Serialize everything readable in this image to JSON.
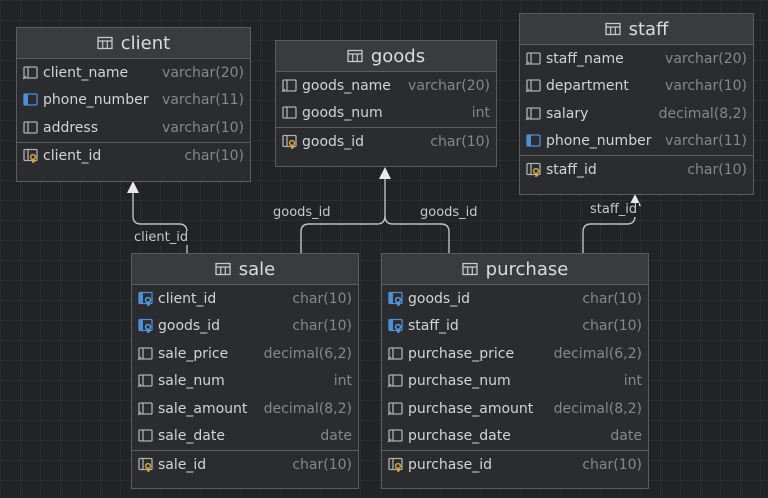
{
  "tables": {
    "client": {
      "title": "client",
      "fields": [
        {
          "name": "client_name",
          "type": "varchar(20)",
          "icon": "column-icon"
        },
        {
          "name": "phone_number",
          "type": "varchar(11)",
          "icon": "column-unique-icon"
        },
        {
          "name": "address",
          "type": "varchar(10)",
          "icon": "column-plain-icon"
        }
      ],
      "key": {
        "name": "client_id",
        "type": "char(10)",
        "icon": "primary-key-icon"
      }
    },
    "goods": {
      "title": "goods",
      "fields": [
        {
          "name": "goods_name",
          "type": "varchar(20)",
          "icon": "column-icon"
        },
        {
          "name": "goods_num",
          "type": "int",
          "icon": "column-plain-icon"
        }
      ],
      "key": {
        "name": "goods_id",
        "type": "char(10)",
        "icon": "primary-key-icon"
      }
    },
    "staff": {
      "title": "staff",
      "fields": [
        {
          "name": "staff_name",
          "type": "varchar(20)",
          "icon": "column-icon"
        },
        {
          "name": "department",
          "type": "varchar(10)",
          "icon": "column-icon"
        },
        {
          "name": "salary",
          "type": "decimal(8,2)",
          "icon": "column-icon"
        },
        {
          "name": "phone_number",
          "type": "varchar(11)",
          "icon": "column-unique-icon"
        }
      ],
      "key": {
        "name": "staff_id",
        "type": "char(10)",
        "icon": "primary-key-icon"
      }
    },
    "sale": {
      "title": "sale",
      "fields": [
        {
          "name": "client_id",
          "type": "char(10)",
          "icon": "foreign-key-icon"
        },
        {
          "name": "goods_id",
          "type": "char(10)",
          "icon": "foreign-key-icon"
        },
        {
          "name": "sale_price",
          "type": "decimal(6,2)",
          "icon": "column-icon"
        },
        {
          "name": "sale_num",
          "type": "int",
          "icon": "column-icon"
        },
        {
          "name": "sale_amount",
          "type": "decimal(8,2)",
          "icon": "column-icon"
        },
        {
          "name": "sale_date",
          "type": "date",
          "icon": "column-plain-icon"
        }
      ],
      "key": {
        "name": "sale_id",
        "type": "char(10)",
        "icon": "primary-key-icon"
      }
    },
    "purchase": {
      "title": "purchase",
      "fields": [
        {
          "name": "goods_id",
          "type": "char(10)",
          "icon": "foreign-key-icon"
        },
        {
          "name": "staff_id",
          "type": "char(10)",
          "icon": "foreign-key-icon"
        },
        {
          "name": "purchase_price",
          "type": "decimal(6,2)",
          "icon": "column-icon"
        },
        {
          "name": "purchase_num",
          "type": "int",
          "icon": "column-icon"
        },
        {
          "name": "purchase_amount",
          "type": "decimal(8,2)",
          "icon": "column-icon"
        },
        {
          "name": "purchase_date",
          "type": "date",
          "icon": "column-icon"
        }
      ],
      "key": {
        "name": "purchase_id",
        "type": "char(10)",
        "icon": "primary-key-icon"
      }
    }
  },
  "links": [
    {
      "from": "sale",
      "to": "client",
      "label": "client_id"
    },
    {
      "from": "sale",
      "to": "goods",
      "label": "goods_id"
    },
    {
      "from": "purchase",
      "to": "goods",
      "label": "goods_id"
    },
    {
      "from": "purchase",
      "to": "staff",
      "label": "staff_id"
    }
  ],
  "colors": {
    "line": "#c0c0c0",
    "column_icon": "#b0b0b0",
    "unique_icon": "#4f8fd6",
    "key_icon": "#d9a43a"
  }
}
